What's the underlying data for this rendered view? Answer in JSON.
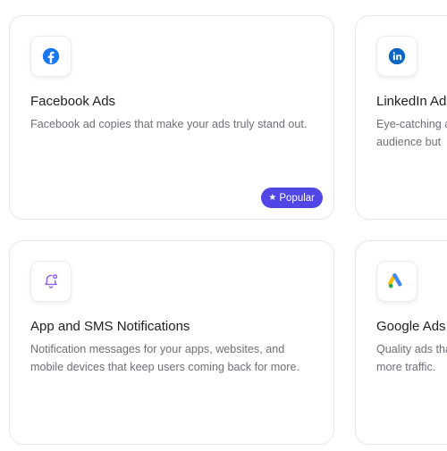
{
  "cards": [
    {
      "title": "Facebook Ads",
      "description": "Facebook ad copies that make your ads truly stand out.",
      "icon": "facebook-icon",
      "badge": "Popular"
    },
    {
      "title": "LinkedIn Ads",
      "description": "Eye-catching ad copies that reach your target audience but",
      "icon": "linkedin-icon"
    },
    {
      "title": "App and SMS Notifications",
      "description": "Notification messages for your apps, websites, and mobile devices that keep users coming back for more.",
      "icon": "bell-icon"
    },
    {
      "title": "Google Ads",
      "description": "Quality ads that rank in the search results and drive more traffic.",
      "icon": "google-ads-icon"
    }
  ],
  "colors": {
    "badge_bg": "#5046e5",
    "facebook_blue": "#1877f2",
    "linkedin_blue": "#0a66c2",
    "bell_purple": "#8b5cf6",
    "google_blue": "#4285f4",
    "google_yellow": "#fbbc04",
    "google_green": "#34a853"
  }
}
